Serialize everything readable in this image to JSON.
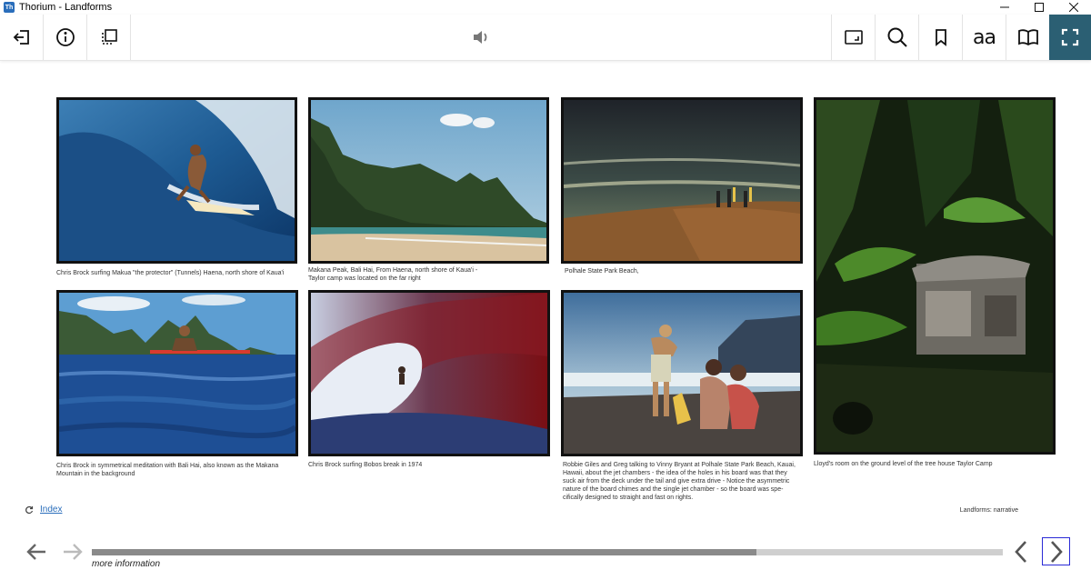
{
  "window": {
    "app_badge": "Th",
    "title": "Thorium - Landforms",
    "minimize_icon": "minimize-icon",
    "maximize_icon": "maximize-icon",
    "close_icon": "close-icon"
  },
  "toolbar": {
    "left_icons": [
      "back-to-library-icon",
      "info-icon",
      "toc-icon"
    ],
    "center_icon": "audio-icon",
    "right_icons": [
      "fullscreen-window-icon",
      "search-icon",
      "bookmark-icon",
      "text-settings-icon",
      "book-layout-icon",
      "fullscreen-icon"
    ],
    "font_button_label": "aa",
    "active_color": "#2b5f73"
  },
  "gallery": {
    "captions": {
      "p1": "Chris Brock surfing Makua \"the protector\" (Tunnels) Haena, north shore of Kaua'i",
      "p2_line1": "Makana Peak, Bali Hai, From Haena, north shore of Kaua'i -",
      "p2_line2": "Taylor camp was located on the far right",
      "p3": "Polhale State Park Beach,",
      "p4_line1": "Chris Brock in symmetrical meditation with Bali Hai, also known as the Makana",
      "p4_line2": "Mountain in the background",
      "p5": "Chris Brock surfing Bobos break in 1974",
      "p6_line1": "Robbie Giles and Greg talking to Vinny Bryant at Polhale State Park Beach, Kauai,",
      "p6_line2": "Hawaii, about the jet chambers - the idea of the holes in his board was that they",
      "p6_line3": "suck air from the deck under the tail and give extra drive - Notice the asymmetric",
      "p6_line4": "nature of the board chimes and the single jet chamber - so the board was spe-",
      "p6_line5": "cifically designed to straight and fast on rights.",
      "p7": "Lloyd's room on the ground level of the tree house Taylor Camp"
    }
  },
  "footer": {
    "index_icon": "refresh-icon",
    "index_label": "Index",
    "section_label": "Landforms: narrative",
    "more_info": "more information",
    "progress_fraction": 0.73
  }
}
